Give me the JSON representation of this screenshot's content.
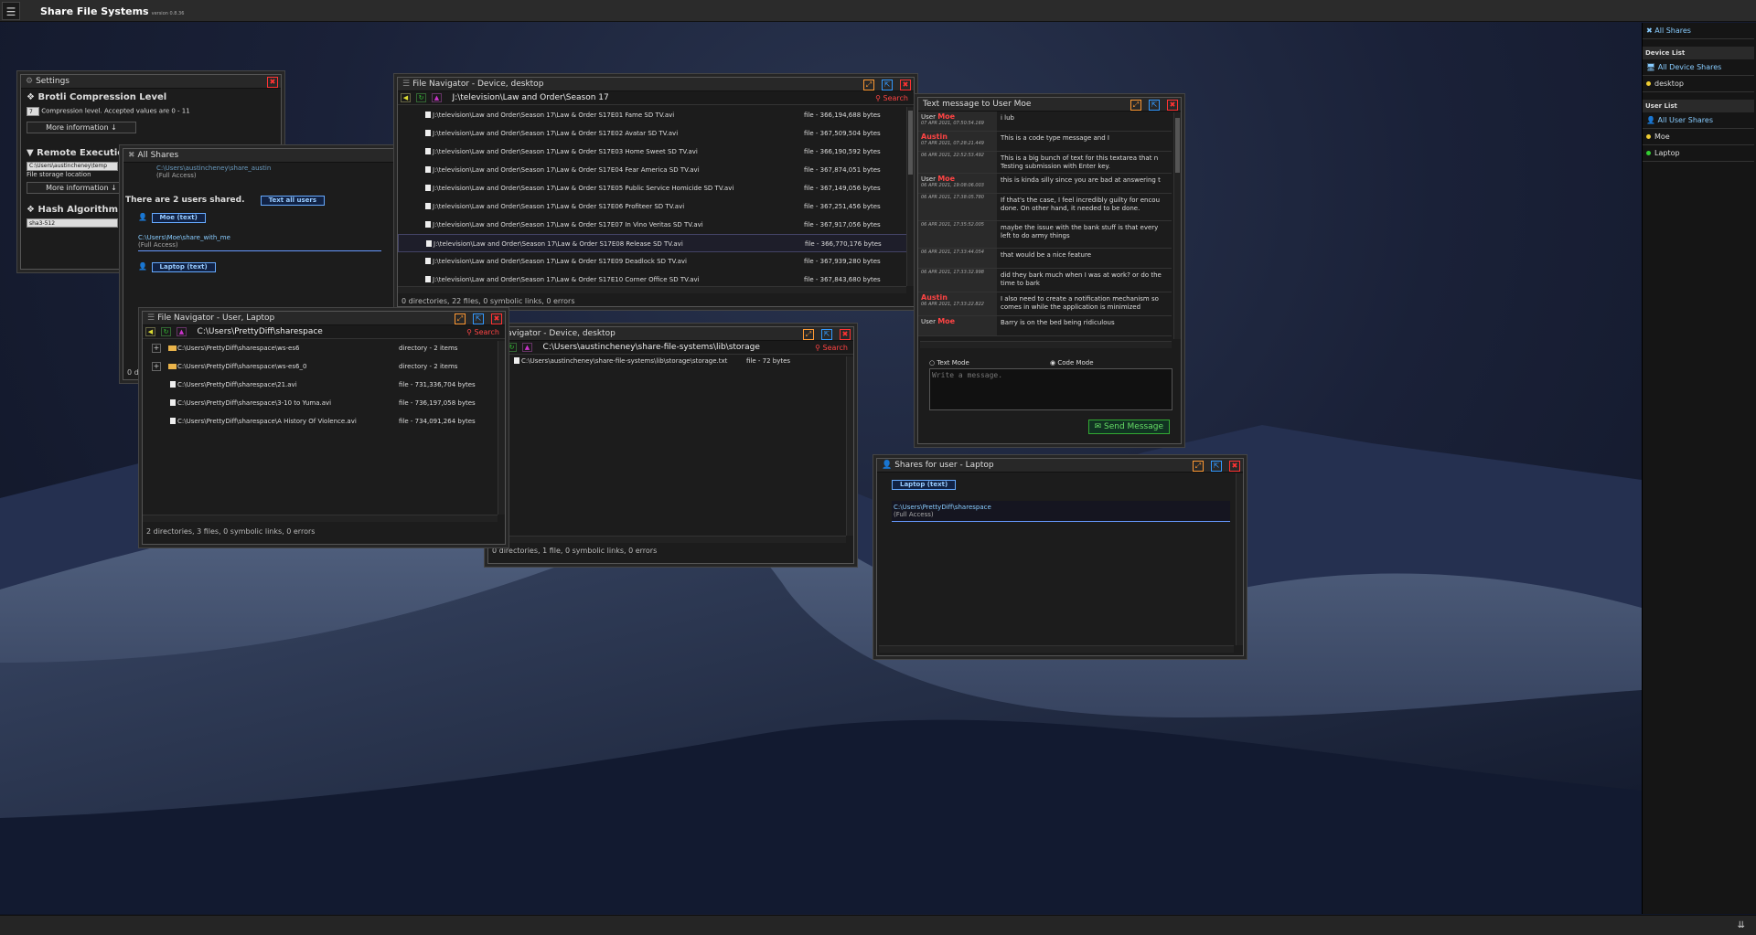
{
  "app": {
    "title": "Share File Systems",
    "version": "version 0.8.36",
    "menu_icon": "hamburger-icon"
  },
  "right_panel": {
    "all_shares": "All Shares",
    "device_list_head": "Device List",
    "all_device_shares": "All Device Shares",
    "devices": [
      "desktop"
    ],
    "user_list_head": "User List",
    "all_user_shares": "All User Shares",
    "users": [
      "Moe",
      "Laptop"
    ]
  },
  "settings": {
    "title": "Settings",
    "brotli_head": "Brotli Compression Level",
    "brotli_value": "7",
    "brotli_desc": "Compression level. Accepted values are 0 - 11",
    "more_info": "More information ↓",
    "remote_head": "Remote Execution",
    "storage_value": "C:\\Users\\austincheney\\temp",
    "storage_label": "File storage location",
    "hash_head": "Hash Algorithm",
    "hash_value": "sha3-512"
  },
  "all_shares": {
    "title": "All Shares",
    "top_path": "C:\\Users\\austincheney\\share_austin",
    "top_access": "(Full Access)",
    "summary": "There are 2 users shared.",
    "text_all": "Text all users",
    "moe_chip": "Moe (text)",
    "moe_path": "C:\\Users\\Moe\\share_with_me",
    "moe_access": "(Full Access)",
    "laptop_chip": "Laptop (text)",
    "partial": "0 d"
  },
  "nav_desktop": {
    "title": "File Navigator - Device, desktop",
    "path": "J:\\television\\Law and Order\\Season 17",
    "search": "Search",
    "files": [
      {
        "name": "J:\\television\\Law and Order\\Season 17\\Law & Order S17E01 Fame SD TV.avi",
        "meta": "file - 366,194,688 bytes"
      },
      {
        "name": "J:\\television\\Law and Order\\Season 17\\Law & Order S17E02 Avatar SD TV.avi",
        "meta": "file - 367,509,504 bytes"
      },
      {
        "name": "J:\\television\\Law and Order\\Season 17\\Law & Order S17E03 Home Sweet SD TV.avi",
        "meta": "file - 366,190,592 bytes"
      },
      {
        "name": "J:\\television\\Law and Order\\Season 17\\Law & Order S17E04 Fear America SD TV.avi",
        "meta": "file - 367,874,051 bytes"
      },
      {
        "name": "J:\\television\\Law and Order\\Season 17\\Law & Order S17E05 Public Service Homicide SD TV.avi",
        "meta": "file - 367,149,056 bytes"
      },
      {
        "name": "J:\\television\\Law and Order\\Season 17\\Law & Order S17E06 Profiteer SD TV.avi",
        "meta": "file - 367,251,456 bytes"
      },
      {
        "name": "J:\\television\\Law and Order\\Season 17\\Law & Order S17E07 In Vino Veritas SD TV.avi",
        "meta": "file - 367,917,056 bytes"
      },
      {
        "name": "J:\\television\\Law and Order\\Season 17\\Law & Order S17E08 Release SD TV.avi",
        "meta": "file - 366,770,176 bytes"
      },
      {
        "name": "J:\\television\\Law and Order\\Season 17\\Law & Order S17E09 Deadlock SD TV.avi",
        "meta": "file - 367,939,280 bytes"
      },
      {
        "name": "J:\\television\\Law and Order\\Season 17\\Law & Order S17E10 Corner Office SD TV.avi",
        "meta": "file - 367,843,680 bytes"
      }
    ],
    "status": "0 directories, 22 files, 0 symbolic links, 0 errors"
  },
  "nav_laptop": {
    "title": "File Navigator - User, Laptop",
    "path": "C:\\Users\\PrettyDiff\\sharespace",
    "search": "Search",
    "dirs": [
      {
        "name": "C:\\Users\\PrettyDiff\\sharespace\\ws-es6",
        "meta": "directory - 2 items"
      },
      {
        "name": "C:\\Users\\PrettyDiff\\sharespace\\ws-es6_0",
        "meta": "directory - 2 items"
      }
    ],
    "files": [
      {
        "name": "C:\\Users\\PrettyDiff\\sharespace\\21.avi",
        "meta": "file - 731,336,704 bytes"
      },
      {
        "name": "C:\\Users\\PrettyDiff\\sharespace\\3-10 to Yuma.avi",
        "meta": "file - 736,197,058 bytes"
      },
      {
        "name": "C:\\Users\\PrettyDiff\\sharespace\\A History Of Violence.avi",
        "meta": "file - 734,091,264 bytes"
      }
    ],
    "status": "2 directories, 3 files, 0 symbolic links, 0 errors"
  },
  "nav_storage": {
    "title": "e Navigator - Device, desktop",
    "path": "C:\\Users\\austincheney\\share-file-systems\\lib\\storage",
    "search": "Search",
    "file": {
      "name": "C:\\Users\\austincheney\\share-file-systems\\lib\\storage\\storage.txt",
      "meta": "file - 72 bytes"
    },
    "status": "0 directories, 1 file, 0 symbolic links, 0 errors"
  },
  "message": {
    "title": "Text message to User Moe",
    "text_mode": "Text Mode",
    "code_mode": "Code Mode",
    "placeholder": "Write a message.",
    "send": "Send Message",
    "items": [
      {
        "who": "User",
        "name": "Moe",
        "ts": "07 APR 2021, 07:50:54.169",
        "text": "i lub"
      },
      {
        "who": "",
        "name": "Austin",
        "ts": "07 APR 2021, 07:28:21.449",
        "text": "This is a code type message and I"
      },
      {
        "who": "",
        "name": "",
        "ts": "06 APR 2021, 22:52:53.492",
        "text": "This is a big bunch of text for this textarea that n\nTesting submission with Enter key."
      },
      {
        "who": "User",
        "name": "Moe",
        "ts": "06 APR 2021, 19:08:06.003",
        "text": "this is kinda silly since you are bad at answering t"
      },
      {
        "who": "",
        "name": "",
        "ts": "06 APR 2021, 17:38:05.780",
        "text": "If that's the case, I feel incredibly guilty for encou\ndone. On other hand, it needed to be done."
      },
      {
        "who": "",
        "name": "",
        "ts": "06 APR 2021, 17:35:52.005",
        "text": "maybe the issue with the bank stuff is that every\nleft to do army things"
      },
      {
        "who": "",
        "name": "",
        "ts": "06 APR 2021, 17:33:44.054",
        "text": "that would be a nice feature"
      },
      {
        "who": "",
        "name": "",
        "ts": "06 APR 2021, 17:33:32.998",
        "text": "did they bark much when I was at work? or do the\ntime to bark"
      },
      {
        "who": "",
        "name": "Austin",
        "ts": "06 APR 2021, 17:33:22.822",
        "text": "I also need to create a notification mechanism so\ncomes in while the application is minimized"
      },
      {
        "who": "User",
        "name": "Moe",
        "ts": "",
        "text": "Barry is on the bed being ridiculous"
      }
    ]
  },
  "laptop_shares": {
    "title": "Shares for user - Laptop",
    "chip": "Laptop (text)",
    "path": "C:\\Users\\PrettyDiff\\sharespace",
    "access": "(Full Access)"
  },
  "colors": {
    "accent": "#66aaff",
    "danger": "#ff4444",
    "ok": "#33cc33"
  }
}
